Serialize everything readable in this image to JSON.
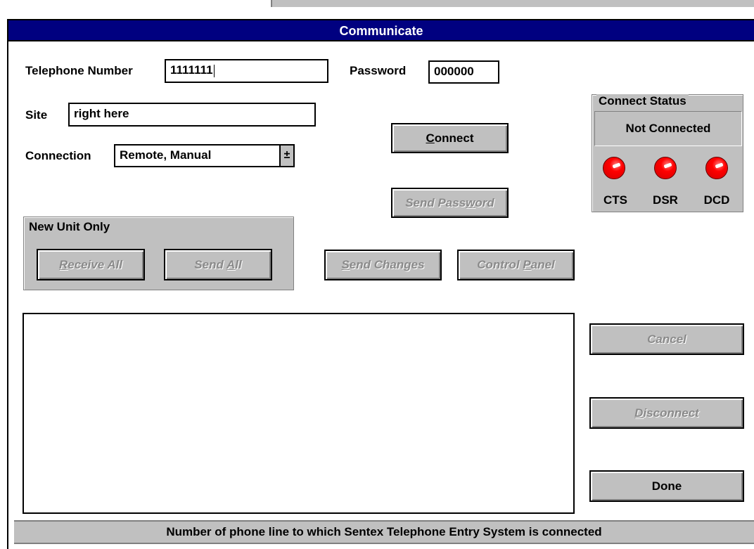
{
  "window": {
    "title": "Communicate"
  },
  "telephone": {
    "label": "Telephone Number",
    "value": "1111111"
  },
  "password": {
    "label": "Password",
    "value": "000000"
  },
  "site": {
    "label": "Site",
    "value": "right here"
  },
  "connection": {
    "label": "Connection",
    "selected": "Remote, Manual",
    "arrow": "±"
  },
  "buttons": {
    "connect": {
      "pre": "",
      "key": "C",
      "post": "onnect"
    },
    "send_password": {
      "pre": "Send Pass",
      "key": "w",
      "post": "ord"
    },
    "receive_all": {
      "pre": "",
      "key": "R",
      "post": "eceive All"
    },
    "send_all": {
      "pre": "Send ",
      "key": "A",
      "post": "ll"
    },
    "send_changes": {
      "pre": "",
      "key": "S",
      "post": "end Changes"
    },
    "control_panel": {
      "pre": "Control ",
      "key": "P",
      "post": "anel"
    },
    "cancel": {
      "label": "Cancel"
    },
    "disconnect": {
      "pre": "",
      "key": "D",
      "post": "isconnect"
    },
    "done": {
      "label": "Done"
    }
  },
  "new_unit_group": {
    "title": "New Unit Only"
  },
  "connect_status": {
    "title": "Connect Status",
    "state": "Not Connected",
    "indicators": [
      {
        "label": "CTS",
        "color": "#ff0000"
      },
      {
        "label": "DSR",
        "color": "#ff0000"
      },
      {
        "label": "DCD",
        "color": "#ff0000"
      }
    ]
  },
  "status_bar": {
    "text": "Number of phone line to which Sentex Telephone Entry System is connected"
  }
}
